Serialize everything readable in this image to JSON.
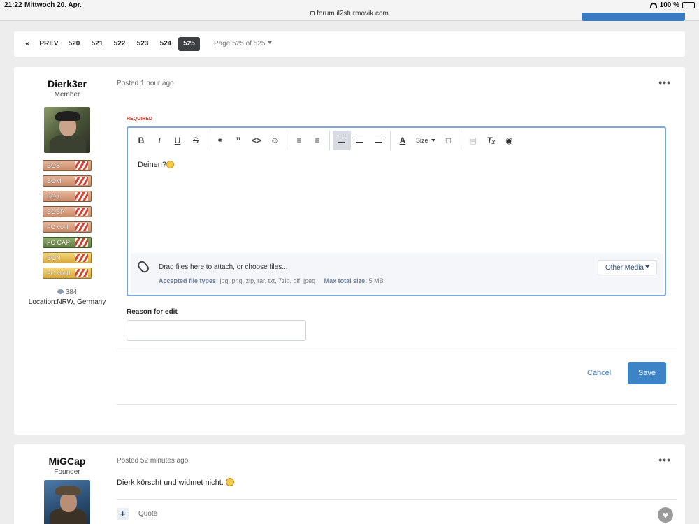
{
  "status_bar": {
    "time": "21:22",
    "date": "Mittwoch 20. Apr.",
    "url": "forum.il2sturmovik.com",
    "battery": "100 %"
  },
  "pagination": {
    "first_label": "«",
    "prev_label": "PREV",
    "pages": [
      "520",
      "521",
      "522",
      "523",
      "524",
      "525"
    ],
    "current_page": "525",
    "page_of": "Page 525 of 525"
  },
  "post1": {
    "author": "Dierk3er",
    "role": "Member",
    "badges": [
      "BOS",
      "BOM",
      "BOK",
      "BOBP",
      "FC vol.I",
      "FC CAP",
      "BON",
      "FC vol.II"
    ],
    "post_count": "384",
    "location": "Location:NRW, Germany",
    "posted": "Posted 1 hour ago",
    "more": "•••",
    "editor": {
      "required_label": "REQUIRED",
      "size_label": "Size",
      "content": "Deinen?",
      "attach_text": "Drag files here to attach, or choose files...",
      "accepted_label": "Accepted file types:",
      "accepted_types": "jpg, png, zip, rar, txt, 7zip, gif, jpeg",
      "max_label": "Max total size:",
      "max_size": "5 MB",
      "other_media": "Other Media"
    },
    "reason_label": "Reason for edit",
    "cancel_label": "Cancel",
    "save_label": "Save"
  },
  "post2": {
    "author": "MiGCap",
    "role": "Founder",
    "posted": "Posted 52 minutes ago",
    "more": "•••",
    "text": "Dierk körscht und widmet nicht.",
    "plus_label": "+",
    "quote_label": "Quote"
  },
  "colors": {
    "accent": "#3d84c6",
    "current_page_bg": "#3d3f42",
    "required": "#c0392b",
    "editor_border": "#7aa7d6"
  },
  "icons": {
    "bold": "B",
    "italic": "I",
    "underline": "U",
    "strike": "S",
    "link": "link-icon",
    "quote": "quote-icon",
    "code": "code-icon",
    "emoji": "emoji-icon",
    "ul": "list-ul-icon",
    "ol": "list-ol-icon",
    "align_left": "align-left-icon",
    "align_center": "align-center-icon",
    "align_right": "align-right-icon",
    "color": "A",
    "preview": "preview-icon",
    "paste": "paste-icon",
    "clear_format": "clear-format-icon",
    "view": "eye-icon"
  }
}
